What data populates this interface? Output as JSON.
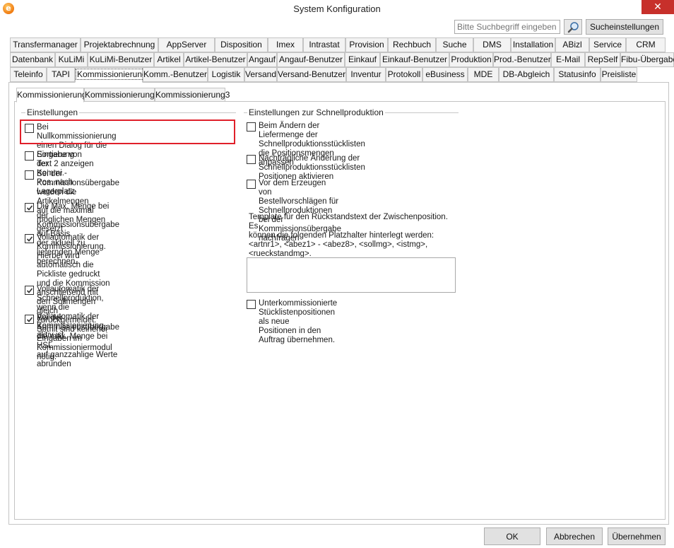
{
  "window": {
    "title": "System Konfiguration",
    "icon_letter": "e",
    "close_symbol": "✕"
  },
  "toolbar": {
    "search_placeholder": "Bitte Suchbegriff eingeben",
    "search_icon": "magnifier-icon",
    "search_settings_label": "Sucheinstellungen"
  },
  "tabs": {
    "row1": [
      "Transfermanager",
      "Projektabrechnung",
      "AppServer",
      "Disposition",
      "Imex",
      "Intrastat",
      "Provision",
      "Rechbuch",
      "Suche",
      "DMS",
      "Installation",
      "ABizl",
      "Service",
      "CRM"
    ],
    "row2": [
      "Datenbank",
      "KuLiMi",
      "KuLiMi-Benutzer",
      "Artikel",
      "Artikel-Benutzer",
      "Angauf",
      "Angauf-Benutzer",
      "Einkauf",
      "Einkauf-Benutzer",
      "Produktion",
      "Prod.-Benutzer",
      "E-Mail",
      "RepSelf",
      "Fibu-Übergabe"
    ],
    "row3": [
      "Teleinfo",
      "TAPI",
      "Kommissionierung",
      "Komm.-Benutzer",
      "Logistik",
      "Versand",
      "Versand-Benutzer",
      "Inventur",
      "Protokoll",
      "eBusiness",
      "MDE",
      "DB-Abgleich",
      "Statusinfo",
      "Preisliste"
    ],
    "active": "Kommissionierung"
  },
  "subtabs": {
    "items": [
      "Kommissionierung",
      "Kommissionierung2",
      "Kommissionierung3"
    ],
    "active": "Kommissionierung"
  },
  "left_group": {
    "title": "Einstellungen",
    "items": [
      {
        "label": "Bei Nullkommissionierung einen Dialog für die Eingabe von\nText 2 anzeigen",
        "checked": false
      },
      {
        "label": "Sortierung der Kommi.-Pos. nach Lagerplatz",
        "checked": false
      },
      {
        "label": "Bei der Kommissionsübergabe werden die Artikelmengen\nauf die maximal möglichen Mengen gesetzt",
        "checked": false
      },
      {
        "label": "Die Max. Menge bei der Kommissionsübergabe auf Basis\nder aktuell zu liefernden Menge berechnen.",
        "checked": true
      },
      {
        "label": "Vollautomatik der Kommissionierung. Hierbei wird\nautomatisch die Pickliste gedruckt und die Kommission\nanschließend mit den Sollmengen gleich zurückgemeldet.\nSomit sind keinerlei Eingaben im Kommissioniermodul nötig.",
        "checked": true
      },
      {
        "label": "Vollautomatik der Schnellproduktion, wenn die\nVollautomatik der Kommissionierung aktiv ist.",
        "checked": true
      },
      {
        "label": "Bei der Kommissionsübergabe die max. Menge bei HSL\nauf ganzzahlige Werte abrunden",
        "checked": true
      }
    ]
  },
  "right_group": {
    "title": "Einstellungen zur Schnellproduktion",
    "items": [
      {
        "label": "Beim Ändern der Liefermenge der\nSchnellproduktionsstücklisten die Positionsmengen\nanpassen",
        "checked": false
      },
      {
        "label": "Nachträgliche Änderung der Schnellproduktionsstücklisten\nPositionen aktivieren",
        "checked": false
      },
      {
        "label": "Vor dem Erzeugen von Bestellvorschlägen für\nSchnellproduktionen bei der Kommissionsübergabe\nnachfragen",
        "checked": false
      }
    ],
    "template_label": "Template für den Rückstandstext der Zwischenposition. Es\nkönnen die folgenden Platzhalter hinterlegt werden:\n<artnr1>, <abez1> - <abez8>, <sollmg>, <istmg>,\n<rueckstandmg>.",
    "template_value": "",
    "last_item": {
      "label": "Unterkommissionierte Stücklistenpositionen als neue\nPositionen in den Auftrag übernehmen.",
      "checked": false
    }
  },
  "footer": {
    "ok_label": "OK",
    "cancel_label": "Abbrechen",
    "apply_label": "Übernehmen"
  },
  "colors": {
    "highlight": "#e0202a",
    "close": "#c7302b"
  }
}
